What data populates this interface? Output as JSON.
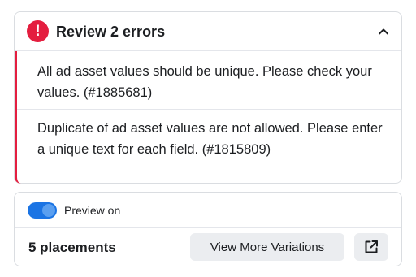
{
  "errors": {
    "title": "Review 2 errors",
    "icon": "exclamation-icon",
    "collapse_icon": "chevron-up-icon",
    "accent_color": "#e41e3f",
    "items": [
      {
        "message": "All ad asset values should be unique. Please check your values. (#1885681)"
      },
      {
        "message": "Duplicate of ad asset values are not allowed. Please enter a unique text for each field. (#1815809)"
      }
    ]
  },
  "preview": {
    "toggle_state": "on",
    "toggle_color": "#1b74e4",
    "label": "Preview on"
  },
  "placements": {
    "count_label": "5 placements",
    "variations_button": "View More Variations",
    "open_icon": "external-link-icon"
  }
}
